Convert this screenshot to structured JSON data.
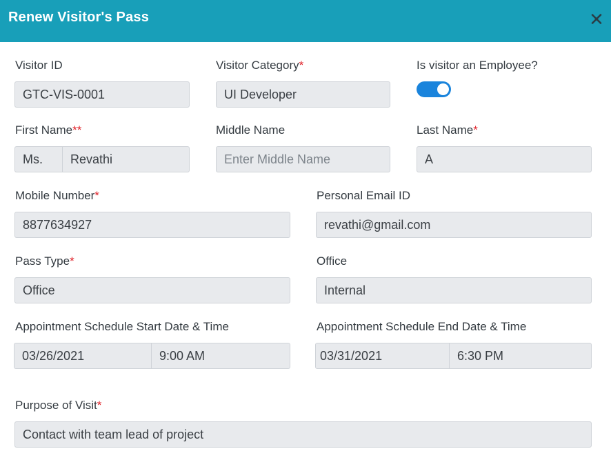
{
  "dialog": {
    "title": "Renew Visitor's Pass",
    "close_glyph": "✕"
  },
  "form": {
    "visitor_id": {
      "label": "Visitor ID",
      "value": "GTC-VIS-0001"
    },
    "visitor_category": {
      "label": "Visitor Category",
      "required_mark": "*",
      "value": "UI Developer"
    },
    "is_employee": {
      "label": "Is visitor an Employee?",
      "checked": true
    },
    "first_name": {
      "label": "First Name",
      "required_mark": "**",
      "salutation": "Ms.",
      "value": "Revathi"
    },
    "middle_name": {
      "label": "Middle Name",
      "placeholder": "Enter Middle Name",
      "value": ""
    },
    "last_name": {
      "label": "Last Name",
      "required_mark": "*",
      "value": "A"
    },
    "mobile_number": {
      "label": "Mobile Number",
      "required_mark": "*",
      "value": "8877634927"
    },
    "personal_email": {
      "label": "Personal Email ID",
      "value": "revathi@gmail.com"
    },
    "pass_type": {
      "label": "Pass Type",
      "required_mark": "*",
      "value": "Office"
    },
    "office": {
      "label": "Office",
      "value": "Internal"
    },
    "start_schedule": {
      "label": "Appointment Schedule Start Date & Time",
      "date": "03/26/2021",
      "time": "9:00 AM"
    },
    "end_schedule": {
      "label": "Appointment Schedule End Date & Time",
      "date": "03/31/2021",
      "time": "6:30 PM"
    },
    "purpose": {
      "label": "Purpose of Visit",
      "required_mark": "*",
      "value": "Contact with team lead of project"
    }
  },
  "colors": {
    "header_bg": "#189fb9",
    "toggle_on": "#1a84dc",
    "required": "#e0242b",
    "field_bg": "#e8eaed"
  }
}
